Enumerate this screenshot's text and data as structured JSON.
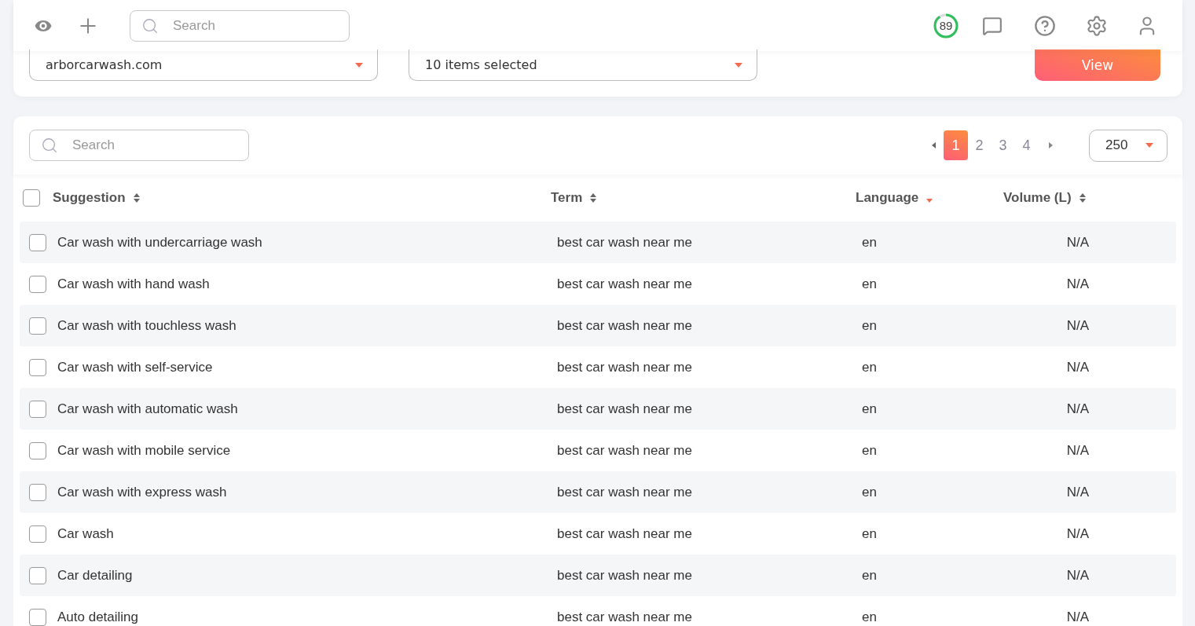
{
  "header": {
    "search": {
      "placeholder": "Search"
    },
    "score": {
      "value": "89"
    }
  },
  "filters": {
    "domain": "arborcarwash.com",
    "items": "10 items selected",
    "button": "View"
  },
  "table_toolbar": {
    "search": {
      "placeholder": "Search"
    },
    "pages": [
      {
        "label": "1",
        "selected": true
      },
      {
        "label": "2",
        "selected": false
      },
      {
        "label": "3",
        "selected": false
      },
      {
        "label": "4",
        "selected": false
      }
    ],
    "page_size": "250"
  },
  "table": {
    "all_checked": false,
    "columns": [
      {
        "label": "Suggestion",
        "sorted": false
      },
      {
        "label": "Term",
        "sorted": false
      },
      {
        "label": "Language",
        "sorted": true
      },
      {
        "label": "Volume (L)",
        "sorted": false
      }
    ],
    "rows": [
      {
        "checked": false,
        "cells": [
          "Car wash with undercarriage wash",
          "best car wash near me",
          "en",
          "N/A"
        ]
      },
      {
        "checked": false,
        "cells": [
          "Car wash with hand wash",
          "best car wash near me",
          "en",
          "N/A"
        ]
      },
      {
        "checked": false,
        "cells": [
          "Car wash with touchless wash",
          "best car wash near me",
          "en",
          "N/A"
        ]
      },
      {
        "checked": false,
        "cells": [
          "Car wash with self-service",
          "best car wash near me",
          "en",
          "N/A"
        ]
      },
      {
        "checked": false,
        "cells": [
          "Car wash with automatic wash",
          "best car wash near me",
          "en",
          "N/A"
        ]
      },
      {
        "checked": false,
        "cells": [
          "Car wash with mobile service",
          "best car wash near me",
          "en",
          "N/A"
        ]
      },
      {
        "checked": false,
        "cells": [
          "Car wash with express wash",
          "best car wash near me",
          "en",
          "N/A"
        ]
      },
      {
        "checked": false,
        "cells": [
          "Car wash",
          "best car wash near me",
          "en",
          "N/A"
        ]
      },
      {
        "checked": false,
        "cells": [
          "Car detailing",
          "best car wash near me",
          "en",
          "N/A"
        ]
      },
      {
        "checked": false,
        "cells": [
          "Auto detailing",
          "best car wash near me",
          "en",
          "N/A"
        ]
      }
    ]
  }
}
